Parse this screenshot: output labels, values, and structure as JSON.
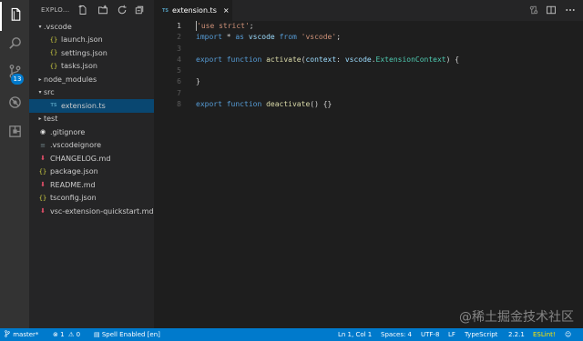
{
  "sidebar": {
    "title": "EXPLO...",
    "items": [
      {
        "label": ".vscode",
        "twisty": "▾",
        "icon": "",
        "icon_class": "",
        "indent": 0
      },
      {
        "label": "launch.json",
        "twisty": "",
        "icon": "{}",
        "icon_class": "json",
        "indent": 1
      },
      {
        "label": "settings.json",
        "twisty": "",
        "icon": "{}",
        "icon_class": "json",
        "indent": 1
      },
      {
        "label": "tasks.json",
        "twisty": "",
        "icon": "{}",
        "icon_class": "json",
        "indent": 1
      },
      {
        "label": "node_modules",
        "twisty": "▸",
        "icon": "",
        "icon_class": "",
        "indent": 0
      },
      {
        "label": "src",
        "twisty": "▾",
        "icon": "",
        "icon_class": "",
        "indent": 0
      },
      {
        "label": "extension.ts",
        "twisty": "",
        "icon": "TS",
        "icon_class": "ts",
        "indent": 1,
        "selected": true
      },
      {
        "label": "test",
        "twisty": "▸",
        "icon": "",
        "icon_class": "",
        "indent": 0
      },
      {
        "label": ".gitignore",
        "twisty": "",
        "icon": "◉",
        "icon_class": "git",
        "indent": 0
      },
      {
        "label": ".vscodeignore",
        "twisty": "",
        "icon": "≡",
        "icon_class": "ign",
        "indent": 0
      },
      {
        "label": "CHANGELOG.md",
        "twisty": "",
        "icon": "⬇",
        "icon_class": "md",
        "indent": 0
      },
      {
        "label": "package.json",
        "twisty": "",
        "icon": "{}",
        "icon_class": "json",
        "indent": 0
      },
      {
        "label": "README.md",
        "twisty": "",
        "icon": "⬇",
        "icon_class": "md",
        "indent": 0
      },
      {
        "label": "tsconfig.json",
        "twisty": "",
        "icon": "{}",
        "icon_class": "json",
        "indent": 0
      },
      {
        "label": "vsc-extension-quickstart.md",
        "twisty": "",
        "icon": "⬇",
        "icon_class": "md",
        "indent": 0
      }
    ]
  },
  "activity": {
    "icons": [
      "files-icon",
      "search-icon",
      "source-control-icon",
      "debug-icon",
      "extensions-icon"
    ],
    "scm_badge": "13"
  },
  "editor": {
    "tab": {
      "lang": "TS",
      "label": "extension.ts",
      "close": "×"
    },
    "current_line": 1,
    "lines": [
      [
        {
          "t": "'use strict'",
          "c": "str"
        },
        {
          "t": ";",
          "c": ""
        }
      ],
      [
        {
          "t": "import",
          "c": "kw"
        },
        {
          "t": " * ",
          "c": ""
        },
        {
          "t": "as",
          "c": "kw"
        },
        {
          "t": " ",
          "c": ""
        },
        {
          "t": "vscode",
          "c": "var"
        },
        {
          "t": " ",
          "c": ""
        },
        {
          "t": "from",
          "c": "kw"
        },
        {
          "t": " ",
          "c": ""
        },
        {
          "t": "'vscode'",
          "c": "str"
        },
        {
          "t": ";",
          "c": ""
        }
      ],
      [],
      [
        {
          "t": "export",
          "c": "kw"
        },
        {
          "t": " ",
          "c": ""
        },
        {
          "t": "function",
          "c": "kw"
        },
        {
          "t": " ",
          "c": ""
        },
        {
          "t": "activate",
          "c": "fn"
        },
        {
          "t": "(",
          "c": ""
        },
        {
          "t": "context",
          "c": "var"
        },
        {
          "t": ": ",
          "c": ""
        },
        {
          "t": "vscode",
          "c": "var"
        },
        {
          "t": ".",
          "c": ""
        },
        {
          "t": "ExtensionContext",
          "c": "typ"
        },
        {
          "t": ") {",
          "c": ""
        }
      ],
      [],
      [
        {
          "t": "}",
          "c": ""
        }
      ],
      [],
      [
        {
          "t": "export",
          "c": "kw"
        },
        {
          "t": " ",
          "c": ""
        },
        {
          "t": "function",
          "c": "kw"
        },
        {
          "t": " ",
          "c": ""
        },
        {
          "t": "deactivate",
          "c": "fn"
        },
        {
          "t": "() {}",
          "c": ""
        }
      ]
    ]
  },
  "watermark": "@稀土掘金技术社区",
  "status": {
    "branch": "master*",
    "errors": "1",
    "warnings": "0",
    "spell": "Spell Enabled [en]",
    "position": "Ln 1, Col 1",
    "spaces": "Spaces: 4",
    "encoding": "UTF-8",
    "eol": "LF",
    "language": "TypeScript",
    "version": "2.2.1",
    "eslint": "ESLint!"
  },
  "colors": {
    "accent": "#007acc",
    "selection": "#094771",
    "keyword": "#569cd6",
    "string": "#ce9178",
    "function": "#dcdcaa",
    "variable": "#9cdcfe",
    "type": "#4ec9b0"
  }
}
